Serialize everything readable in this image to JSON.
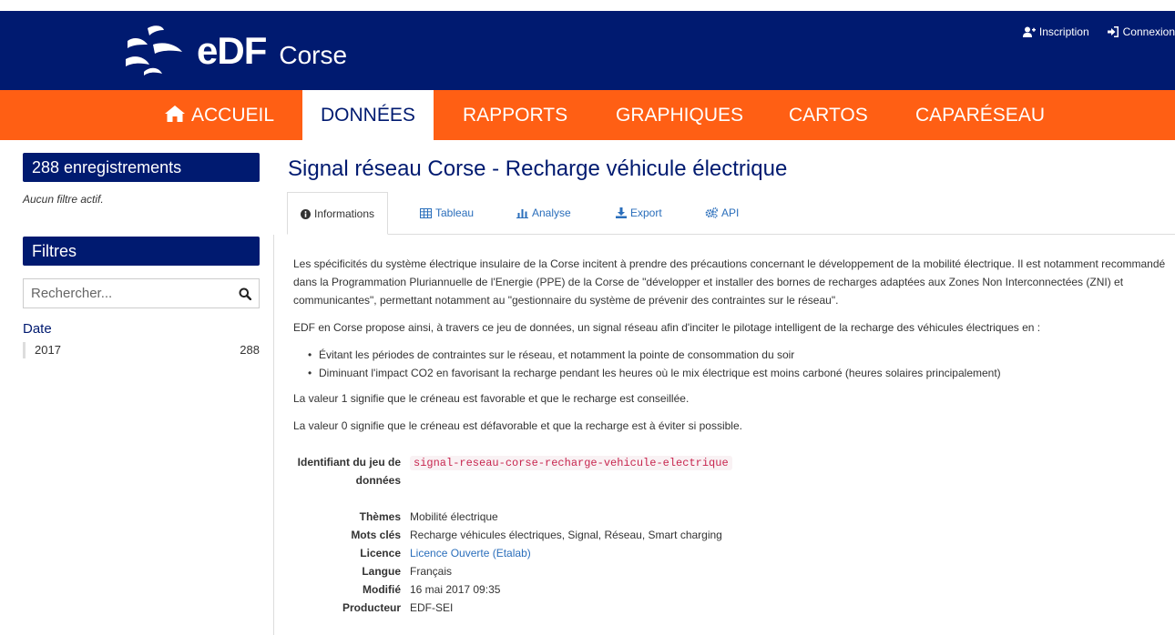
{
  "colors": {
    "header_bg": "#001a70",
    "nav_bg": "#ff5f14",
    "accent_blue": "#2a6ebb"
  },
  "header": {
    "brand": "eDF",
    "region": "Corse",
    "signup": "Inscription",
    "login": "Connexion"
  },
  "nav": {
    "items": [
      "ACCUEIL",
      "DONNÉES",
      "RAPPORTS",
      "GRAPHIQUES",
      "CARTOS",
      "CAPARÉSEAU"
    ],
    "active": "DONNÉES"
  },
  "sidebar": {
    "records": "288 enregistrements",
    "no_filter": "Aucun filtre actif.",
    "filters_title": "Filtres",
    "search_placeholder": "Rechercher...",
    "facet_label": "Date",
    "facets": [
      {
        "label": "2017",
        "count": "288"
      }
    ]
  },
  "main": {
    "title": "Signal réseau Corse - Recharge véhicule électrique",
    "tabs": [
      "Informations",
      "Tableau",
      "Analyse",
      "Export",
      "API"
    ],
    "active_tab": "Informations",
    "para1": "Les spécificités du système électrique insulaire de la Corse incitent à prendre des précautions concernant le développement de la mobilité électrique. Il est notamment recommandé dans la Programmation Pluriannuelle de l'Energie (PPE) de la Corse de \"développer et installer des bornes de recharges adaptées aux Zones Non Interconnectées (ZNI) et communicantes\", permettant notamment au \"gestionnaire du système de prévenir des contraintes sur le réseau\".",
    "para2": "EDF en Corse propose ainsi, à travers ce jeu de données, un signal réseau afin d'inciter le pilotage intelligent de la recharge des véhicules électriques en :",
    "bullets": [
      "Évitant les périodes de contraintes sur le réseau, et notamment la pointe de consommation du soir",
      "Diminuant l'impact CO2 en favorisant la recharge pendant les heures où le mix électrique est moins carboné (heures solaires principalement)"
    ],
    "para3": "La valeur 1 signifie que le créneau est favorable et que le recharge est conseillée.",
    "para4": "La valeur 0 signifie que le créneau est défavorable et que la recharge est à éviter si possible.",
    "meta": {
      "id_label": "Identifiant du jeu de données",
      "id_value": "signal-reseau-corse-recharge-vehicule-electrique",
      "themes_label": "Thèmes",
      "themes_value": "Mobilité électrique",
      "keywords_label": "Mots clés",
      "keywords_value": "Recharge véhicules électriques, Signal, Réseau, Smart charging",
      "licence_label": "Licence",
      "licence_value": "Licence Ouverte (Etalab)",
      "language_label": "Langue",
      "language_value": "Français",
      "modified_label": "Modifié",
      "modified_value": "16 mai 2017 09:35",
      "producer_label": "Producteur",
      "producer_value": "EDF-SEI"
    }
  }
}
